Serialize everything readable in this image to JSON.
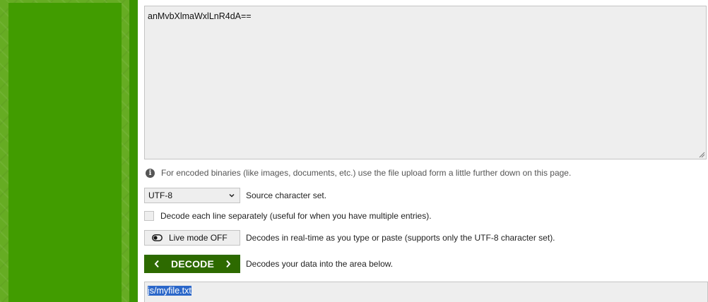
{
  "input": {
    "value": "anMvbXlmaWxlLnR4dA=="
  },
  "hint": {
    "text": "For encoded binaries (like images, documents, etc.) use the file upload form a little further down on this page."
  },
  "charset": {
    "selected": "UTF-8",
    "description": "Source character set."
  },
  "each_line": {
    "label": "Decode each line separately (useful for when you have multiple entries).",
    "checked": false
  },
  "live_mode": {
    "label": "Live mode OFF",
    "description": "Decodes in real-time as you type or paste (supports only the UTF-8 character set)."
  },
  "decode": {
    "label": "DECODE",
    "description": "Decodes your data into the area below."
  },
  "output": {
    "value": "js/myfile.txt"
  },
  "colors": {
    "brand_green": "#419c00",
    "decode_button": "#2d6a00",
    "selection": "#2b67c9"
  },
  "icons": [
    "info-icon",
    "chevron-down-icon",
    "toggle-icon",
    "chevron-left-icon",
    "chevron-right-icon",
    "resize-handle-icon"
  ]
}
